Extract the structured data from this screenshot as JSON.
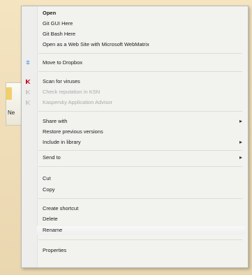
{
  "desktop": {
    "file_label": "Ne"
  },
  "menu": {
    "items": [
      {
        "label": "Open"
      },
      {
        "label": "Git GUI Here"
      },
      {
        "label": "Git Bash Here"
      },
      {
        "label": "Open as a Web Site with Microsoft WebMatrix"
      },
      {
        "label": "Move to Dropbox"
      },
      {
        "label": "Scan for viruses"
      },
      {
        "label": "Check reputation in KSN"
      },
      {
        "label": "Kaspersky Application Advisor"
      },
      {
        "label": "Share with"
      },
      {
        "label": "Restore previous versions"
      },
      {
        "label": "Include in library"
      },
      {
        "label": "Send to"
      },
      {
        "label": "Cut"
      },
      {
        "label": "Copy"
      },
      {
        "label": "Create shortcut"
      },
      {
        "label": "Delete"
      },
      {
        "label": "Rename"
      },
      {
        "label": "Properties"
      }
    ],
    "submenu_arrow": "▸"
  },
  "colors": {
    "menu_bg": "#f2f2ef",
    "kaspersky_red": "#c8102e",
    "disabled": "#a9a9a9"
  }
}
